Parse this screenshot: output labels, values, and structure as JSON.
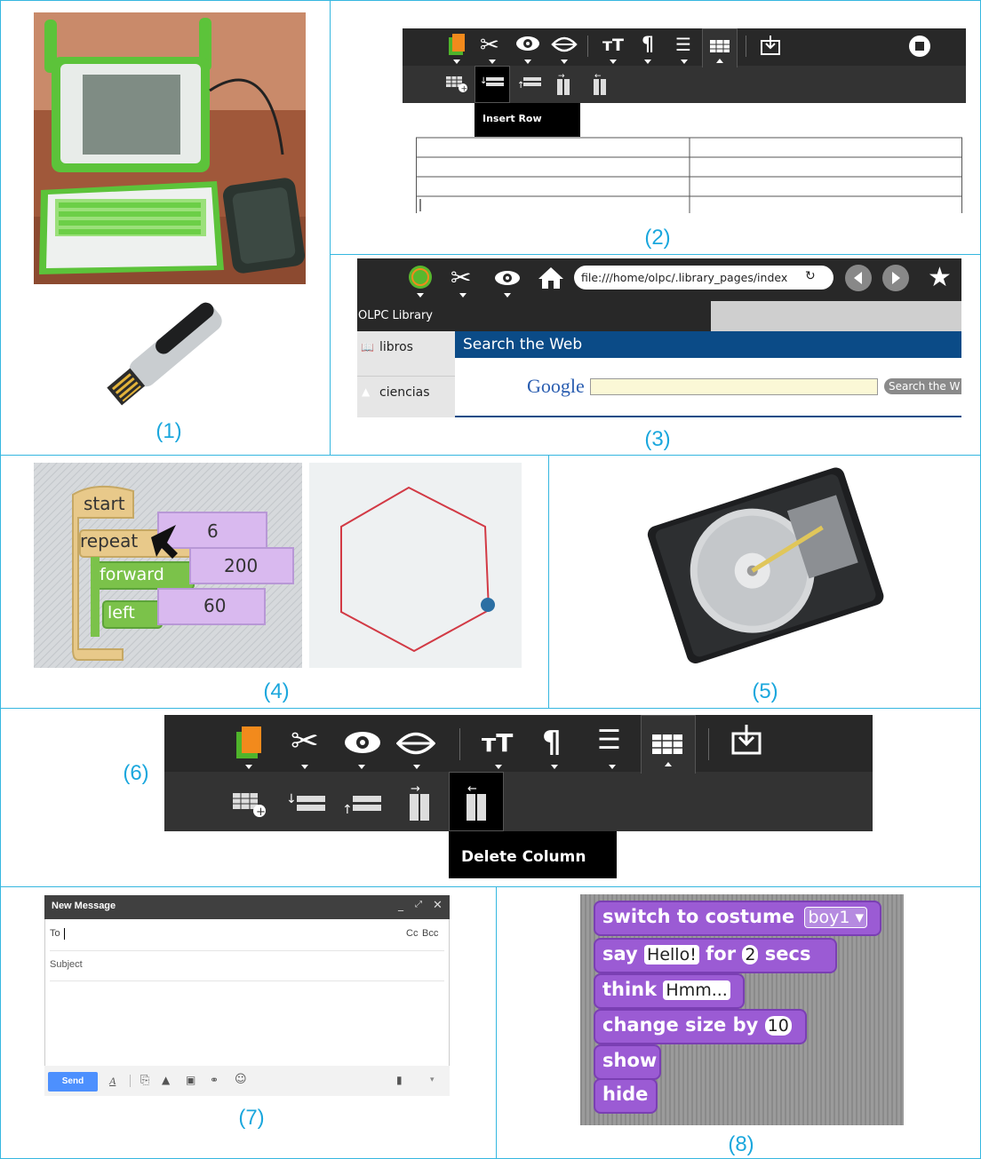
{
  "captions": [
    "(1)",
    "(2)",
    "(3)",
    "(4)",
    "(5)",
    "(6)",
    "(7)",
    "(8)"
  ],
  "panel2": {
    "tooltip": "Insert Row",
    "table_rows": 4
  },
  "panel3": {
    "url": "file:///home/olpc/.library_pages/index",
    "tab_title": "OLPC Library",
    "sidebar": [
      "libros",
      "ciencias"
    ],
    "search_heading": "Search the Web",
    "google_logo": "Google",
    "search_button": "Search the W"
  },
  "panel4": {
    "blocks": {
      "start": "start",
      "repeat": "repeat",
      "repeat_value": "6",
      "forward": "forward",
      "forward_value": "200",
      "left": "left",
      "left_value": "60"
    }
  },
  "panel6": {
    "tooltip": "Delete Column"
  },
  "panel7": {
    "title": "New Message",
    "to_label": "To",
    "cc": "Cc",
    "bcc": "Bcc",
    "subject_placeholder": "Subject",
    "send": "Send"
  },
  "panel8": {
    "switch_costume": "switch to costume",
    "costume": "boy1",
    "say": "say",
    "say_text": "Hello!",
    "for": "for",
    "say_secs": "2",
    "secs": "secs",
    "think": "think",
    "think_text": "Hmm...",
    "change_size": "change size by",
    "size_value": "10",
    "show": "show",
    "hide": "hide"
  },
  "colors": {
    "accent": "#35b7e0",
    "sugar_bar": "#282828",
    "olpc_green": "#58b82d",
    "scratch_looks": "#9b5bd4",
    "gmail_send": "#4d90fe"
  }
}
